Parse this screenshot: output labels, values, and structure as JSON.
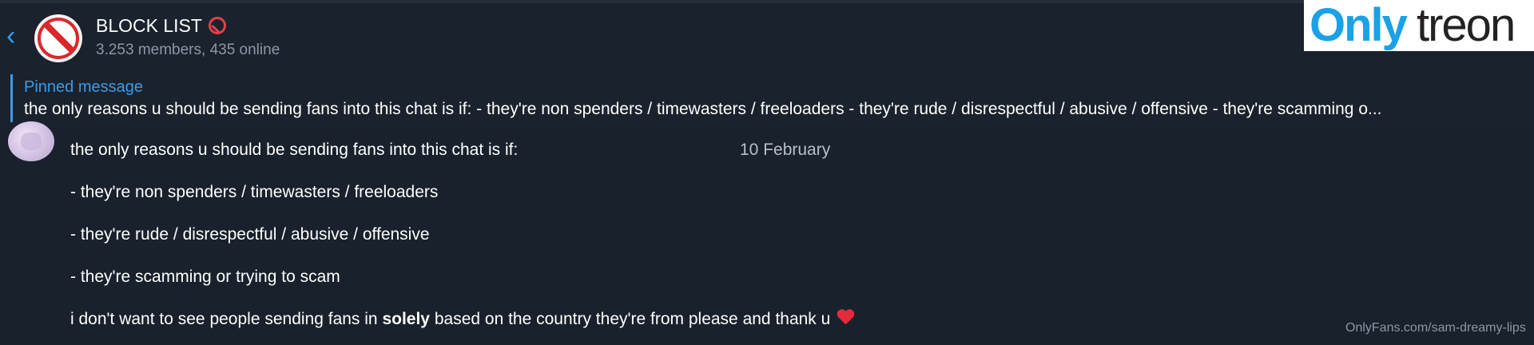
{
  "header": {
    "back_icon": "chevron-left-icon",
    "group_name": "BLOCK LIST",
    "title_icon": "prohibited-icon",
    "members_status": "3.253 members, 435 online"
  },
  "watermark_logo": {
    "only": "Only",
    "treon": "treon"
  },
  "pinned": {
    "label": "Pinned message",
    "text": "the only reasons u should be sending fans into this chat is if:  - they're non spenders / timewasters / freeloaders  - they're rude / disrespectful / abusive / offensive  - they're scamming o..."
  },
  "date_separator": "10 February",
  "message": {
    "line1": "the only reasons u should be sending fans into this chat is if:",
    "line2": "- they're non spenders / timewasters / freeloaders",
    "line3": "- they're rude / disrespectful / abusive / offensive",
    "line4": "- they're scamming or trying to scam",
    "line5_before": "i don't want to see people sending fans in ",
    "line5_bold": "solely",
    "line5_after": " based on the country they're from please and thank u",
    "heart_icon": "red-heart-icon"
  },
  "footer_watermark": "OnlyFans.com/sam-dreamy-lips",
  "colors": {
    "background": "#18212c",
    "accent": "#3b9ae8",
    "prohibited_red": "#d9282a"
  }
}
